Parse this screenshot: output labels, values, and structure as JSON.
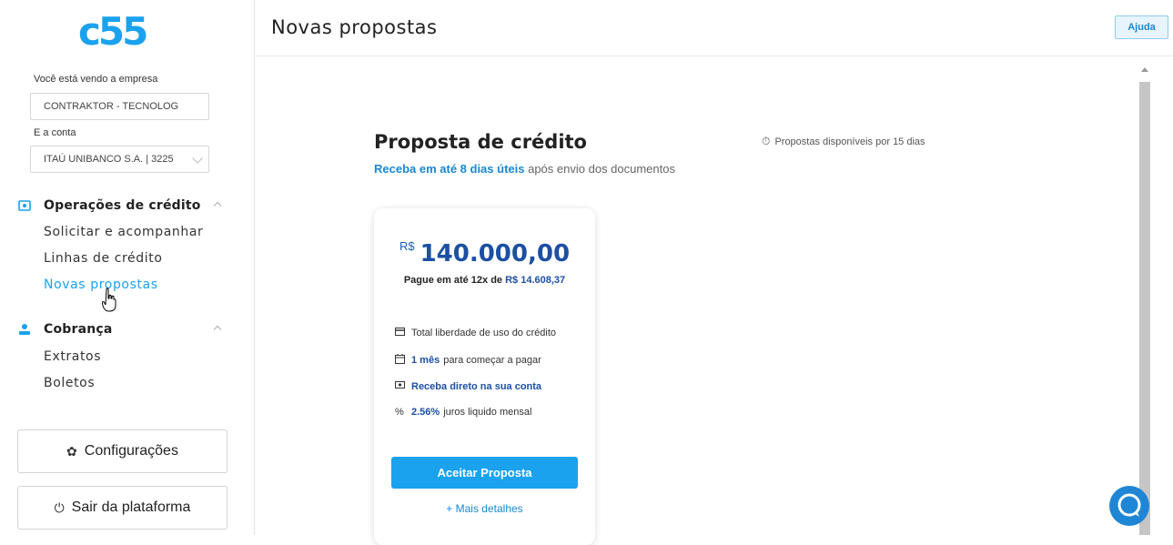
{
  "sidebar": {
    "logo": "c55",
    "company_label": "Você está vendo a empresa",
    "company_value": "CONTRAKTOR - TECNOLOG",
    "account_label": "E a conta",
    "account_value": "ITAÚ UNIBANCO S.A. | 3225",
    "sections": [
      {
        "title": "Operações de crédito",
        "icon": "money-icon",
        "items": [
          "Solicitar e acompanhar",
          "Linhas de crédito",
          "Novas propostas"
        ]
      },
      {
        "title": "Cobrança",
        "icon": "person-icon",
        "items": [
          "Extratos",
          "Boletos"
        ]
      }
    ],
    "settings_label": "Configurações",
    "logout_label": "Sair da plataforma"
  },
  "header": {
    "title": "Novas propostas",
    "help_label": "Ajuda"
  },
  "main": {
    "title": "Proposta de crédito",
    "subtitle_highlight": "Receba em até 8 dias úteis",
    "subtitle_rest": " após envio dos documentos",
    "availability": "Propostas disponíveis por 15 dias",
    "offer": {
      "currency": "R$",
      "amount": "140.000,00",
      "pay_prefix": "Pague em até 12x de",
      "pay_value": "R$ 14.608,37",
      "features": [
        {
          "icon": "card-icon",
          "bold": "",
          "text": "Total liberdade de uso do crédito"
        },
        {
          "icon": "calendar-icon",
          "bold": "1 mês",
          "text": "para começar a pagar"
        },
        {
          "icon": "money-icon",
          "bold": "Receba direto na sua conta",
          "text": ""
        },
        {
          "icon": "percent-icon",
          "bold": "2.56%",
          "text": "juros liquido mensal"
        }
      ],
      "accept_label": "Aceitar Proposta",
      "more_label": "+ Mais detalhes"
    }
  },
  "colors": {
    "accent": "#1aa2ee",
    "brand_dark": "#1d4fa3"
  }
}
